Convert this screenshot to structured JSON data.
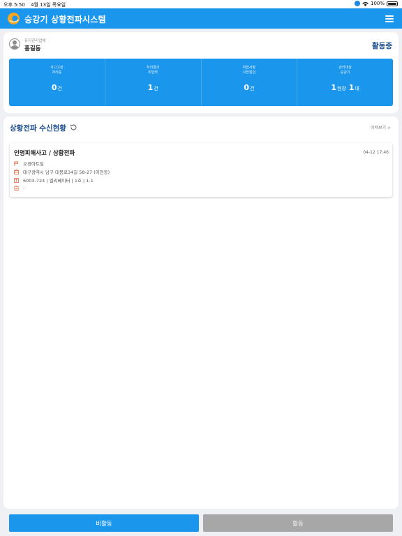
{
  "status_bar": {
    "time": "오후 5:50",
    "date": "4월 13일 목요일",
    "battery": "100%"
  },
  "app": {
    "title": "승강기 상황전파시스템"
  },
  "profile": {
    "company": "유지관리업체",
    "name": "홍길동",
    "status": "활동중"
  },
  "stats": [
    {
      "label_line1": "사고고장",
      "label_line2": "처리중",
      "value": "0",
      "unit": "건"
    },
    {
      "label_line1": "처리결과",
      "label_line2": "미입력",
      "value": "1",
      "unit": "건"
    },
    {
      "label_line1": "위험사항",
      "label_line2": "사전점검",
      "value": "0",
      "unit": "건"
    },
    {
      "label_line1": "관리대상",
      "label_line2": "승강기",
      "value": "1",
      "unit": "현장",
      "value2": "1",
      "unit2": "대"
    }
  ],
  "section": {
    "title": "상황전파 수신현황",
    "history_link": "이력보기 >"
  },
  "incidents": [
    {
      "title": "인명피해사고 / 상황전파",
      "time": "04-12 17:46",
      "building": "오경아트빌",
      "address": "대구광역시 남구 대봉로34길 58-27 (이천동)",
      "elevator": "6003-724 | 엘리베이터 | 1호 | 1-1",
      "note": "-"
    }
  ],
  "buttons": {
    "inactive": "비활동",
    "active": "활동"
  },
  "colors": {
    "primary": "#1a96ec",
    "title_navy": "#1d4f8e",
    "disabled": "#a7a7a7"
  }
}
